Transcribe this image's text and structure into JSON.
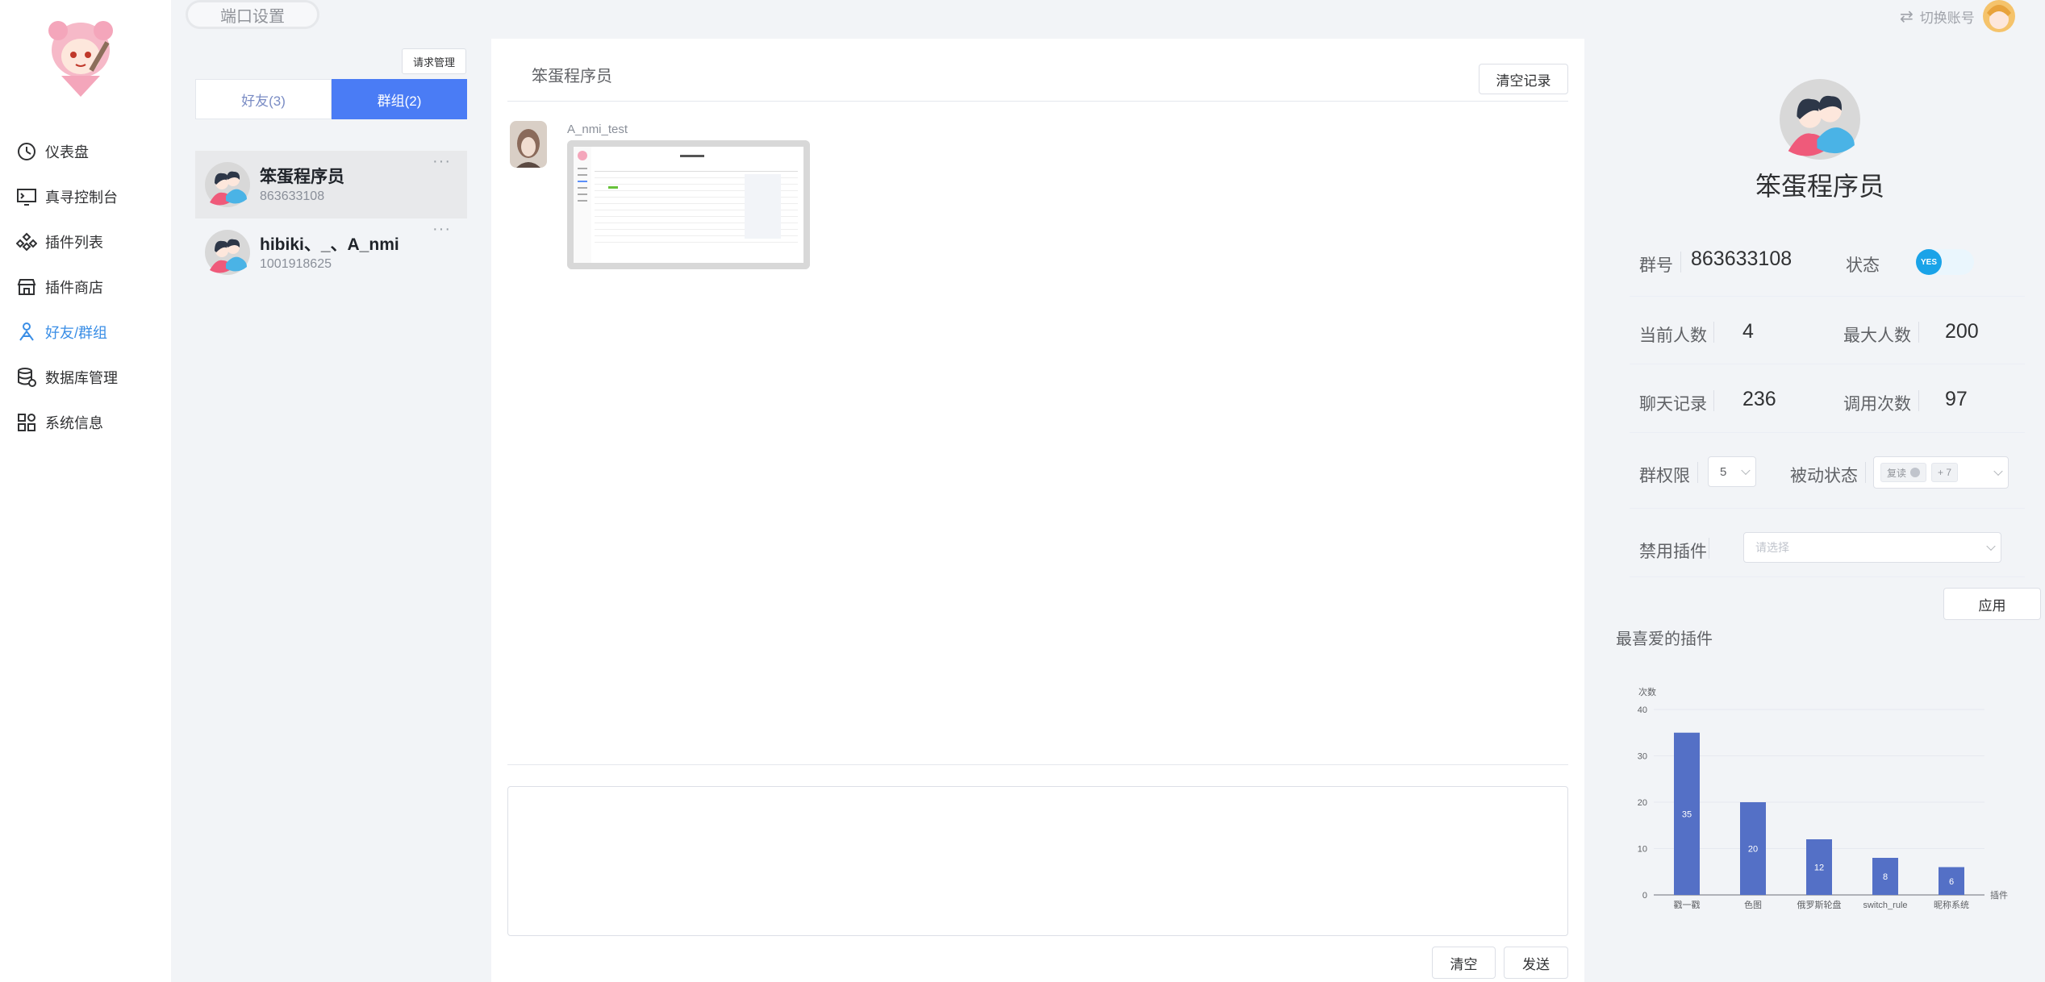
{
  "topbar": {
    "port_settings": "端口设置",
    "switch_account": "切换账号"
  },
  "sidebar": {
    "items": [
      {
        "label": "仪表盘",
        "icon": "dashboard-icon"
      },
      {
        "label": "真寻控制台",
        "icon": "console-icon"
      },
      {
        "label": "插件列表",
        "icon": "plugin-list-icon"
      },
      {
        "label": "插件商店",
        "icon": "store-icon"
      },
      {
        "label": "好友/群组",
        "icon": "friends-icon",
        "active": true
      },
      {
        "label": "数据库管理",
        "icon": "database-icon"
      },
      {
        "label": "系统信息",
        "icon": "grid-icon"
      }
    ]
  },
  "contacts": {
    "request_manage": "请求管理",
    "tab_friends": "好友(3)",
    "tab_groups": "群组(2)",
    "groups": [
      {
        "name": "笨蛋程序员",
        "id": "863633108"
      },
      {
        "name": "hibiki、_、A_nmi",
        "id": "1001918625"
      }
    ],
    "more": "···"
  },
  "chat": {
    "title": "笨蛋程序员",
    "clear_record": "清空记录",
    "message": {
      "sender": "A_nmi_test"
    },
    "clear": "清空",
    "send": "发送"
  },
  "group_info": {
    "name": "笨蛋程序员",
    "group_id_label": "群号",
    "group_id": "863633108",
    "status_label": "状态",
    "status_value": "YES",
    "current_members_label": "当前人数",
    "current_members": "4",
    "max_members_label": "最大人数",
    "max_members": "200",
    "chat_records_label": "聊天记录",
    "chat_records": "236",
    "call_count_label": "调用次数",
    "call_count": "97",
    "permission_label": "群权限",
    "permission_value": "5",
    "passive_label": "被动状态",
    "passive_tag": "复读",
    "passive_more": "+ 7",
    "ban_plugin_label": "禁用插件",
    "ban_plugin_placeholder": "请选择",
    "apply": "应用",
    "fav_plugins_title": "最喜爱的插件"
  },
  "colors": {
    "accent": "#4a7cf5",
    "bar": "#5470c6",
    "active_nav": "#3a8ee6",
    "status_on": "#1aa3e8"
  },
  "chart_data": {
    "type": "bar",
    "categories": [
      "戳一戳",
      "色图",
      "俄罗斯轮盘",
      "switch_rule",
      "昵称系统"
    ],
    "values": [
      35,
      20,
      12,
      8,
      6
    ],
    "title": "",
    "xlabel": "插件",
    "ylabel": "次数",
    "ylim": [
      0,
      40
    ],
    "yticks": [
      0,
      10,
      20,
      30,
      40
    ],
    "grid": true
  }
}
